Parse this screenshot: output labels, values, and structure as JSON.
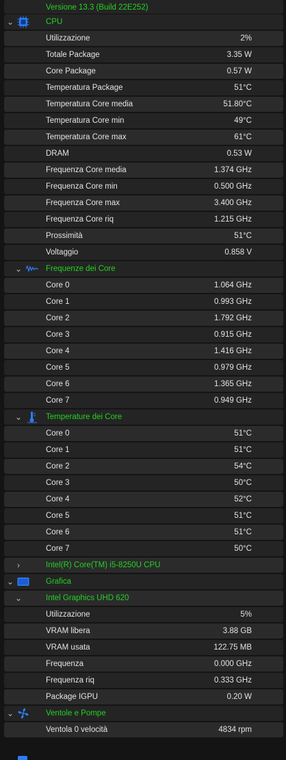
{
  "version": "Versione 13.3 (Build 22E252)",
  "cpu": {
    "label": "CPU",
    "rows": [
      {
        "label": "Utilizzazione",
        "value": "2%"
      },
      {
        "label": "Totale Package",
        "value": "3.35 W"
      },
      {
        "label": "Core Package",
        "value": "0.57 W"
      },
      {
        "label": "Temperatura Package",
        "value": "51°C"
      },
      {
        "label": "Temperatura Core media",
        "value": "51.80°C"
      },
      {
        "label": "Temperatura Core min",
        "value": "49°C"
      },
      {
        "label": "Temperatura Core max",
        "value": "61°C"
      },
      {
        "label": "DRAM",
        "value": "0.53 W"
      },
      {
        "label": "Frequenza Core media",
        "value": "1.374 GHz"
      },
      {
        "label": "Frequenza Core min",
        "value": "0.500 GHz"
      },
      {
        "label": "Frequenza Core max",
        "value": "3.400 GHz"
      },
      {
        "label": "Frequenza Core riq",
        "value": "1.215 GHz"
      },
      {
        "label": "Prossimità",
        "value": "51°C"
      },
      {
        "label": "Voltaggio",
        "value": "0.858 V"
      }
    ]
  },
  "core_freq": {
    "label": "Frequenze dei Core",
    "rows": [
      {
        "label": "Core 0",
        "value": "1.064 GHz"
      },
      {
        "label": "Core 1",
        "value": "0.993 GHz"
      },
      {
        "label": "Core 2",
        "value": "1.792 GHz"
      },
      {
        "label": "Core 3",
        "value": "0.915 GHz"
      },
      {
        "label": "Core 4",
        "value": "1.416 GHz"
      },
      {
        "label": "Core 5",
        "value": "0.979 GHz"
      },
      {
        "label": "Core 6",
        "value": "1.365 GHz"
      },
      {
        "label": "Core 7",
        "value": "0.949 GHz"
      }
    ]
  },
  "core_temp": {
    "label": "Temperature dei Core",
    "rows": [
      {
        "label": "Core 0",
        "value": "51°C"
      },
      {
        "label": "Core 1",
        "value": "51°C"
      },
      {
        "label": "Core 2",
        "value": "54°C"
      },
      {
        "label": "Core 3",
        "value": "50°C"
      },
      {
        "label": "Core 4",
        "value": "52°C"
      },
      {
        "label": "Core 5",
        "value": "51°C"
      },
      {
        "label": "Core 6",
        "value": "51°C"
      },
      {
        "label": "Core 7",
        "value": "50°C"
      }
    ]
  },
  "cpu_model": "Intel(R) Core(TM) i5-8250U CPU",
  "gpu": {
    "label": "Grafica",
    "sub_label": "Intel Graphics UHD 620",
    "rows": [
      {
        "label": "Utilizzazione",
        "value": "5%"
      },
      {
        "label": "VRAM libera",
        "value": "3.88 GB"
      },
      {
        "label": "VRAM usata",
        "value": "122.75 MB"
      },
      {
        "label": "Frequenza",
        "value": "0.000 GHz"
      },
      {
        "label": "Frequenza riq",
        "value": "0.333 GHz"
      },
      {
        "label": "Package IGPU",
        "value": "0.20 W"
      }
    ]
  },
  "fans": {
    "label": "Ventole e Pompe",
    "rows": [
      {
        "label": "Ventola 0 velocità",
        "value": "4834 rpm"
      }
    ]
  },
  "colors": {
    "accent_green": "#21d321",
    "icon_blue": "#2d7cf6"
  },
  "icons": {
    "cpu": "cpu-chip-icon",
    "freq": "waveform-icon",
    "temp": "thermometer-icon",
    "gpu": "display-icon",
    "fan": "fan-icon"
  }
}
